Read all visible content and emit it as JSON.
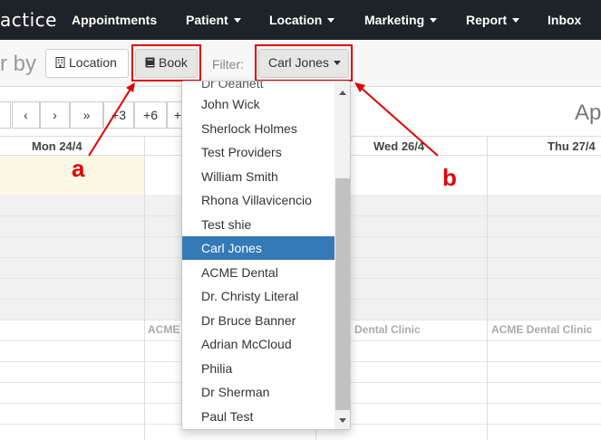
{
  "navbar": {
    "brand": "actice",
    "items": [
      {
        "label": "Appointments",
        "dropdown": false
      },
      {
        "label": "Patient",
        "dropdown": true
      },
      {
        "label": "Location",
        "dropdown": true
      },
      {
        "label": "Marketing",
        "dropdown": true
      },
      {
        "label": "Report",
        "dropdown": true
      },
      {
        "label": "Inbox",
        "dropdown": false
      }
    ]
  },
  "toolbar": {
    "by_text": "r by",
    "location_label": "Location",
    "book_label": "Book",
    "filter_label": "Filter:",
    "filter_value": "Carl Jones"
  },
  "calendar": {
    "nav_buttons": [
      "‹",
      "›",
      "»",
      "+3",
      "+6",
      "+"
    ],
    "title": "Ap",
    "day_headers": [
      "Mon 24/4",
      "Wed 26/4",
      "Thu 27/4"
    ],
    "clinic_labels": [
      "ACME",
      "Dental Clinic",
      "ACME Dental Clinic"
    ]
  },
  "dropdown": {
    "cut_item": "Dr Oeanett",
    "items": [
      "John Wick",
      "Sherlock Holmes",
      "Test Providers",
      "William Smith",
      "Rhona Villavicencio",
      "Test shie",
      "Carl Jones",
      "ACME Dental",
      "Dr. Christy Literal",
      "Dr Bruce Banner",
      "Adrian McCloud",
      "Philia",
      "Dr Sherman",
      "Paul Test"
    ],
    "selected": "Carl Jones"
  },
  "annotations": {
    "a": "a",
    "b": "b"
  },
  "colors": {
    "navbar": "#1e2229",
    "selected": "#337ab7",
    "annotation": "#e00000",
    "today": "#fcf8e3"
  },
  "icons": {
    "location": "building-icon",
    "book": "book-icon",
    "scroll_up": "arrow-up-icon",
    "scroll_down": "arrow-down-icon"
  }
}
